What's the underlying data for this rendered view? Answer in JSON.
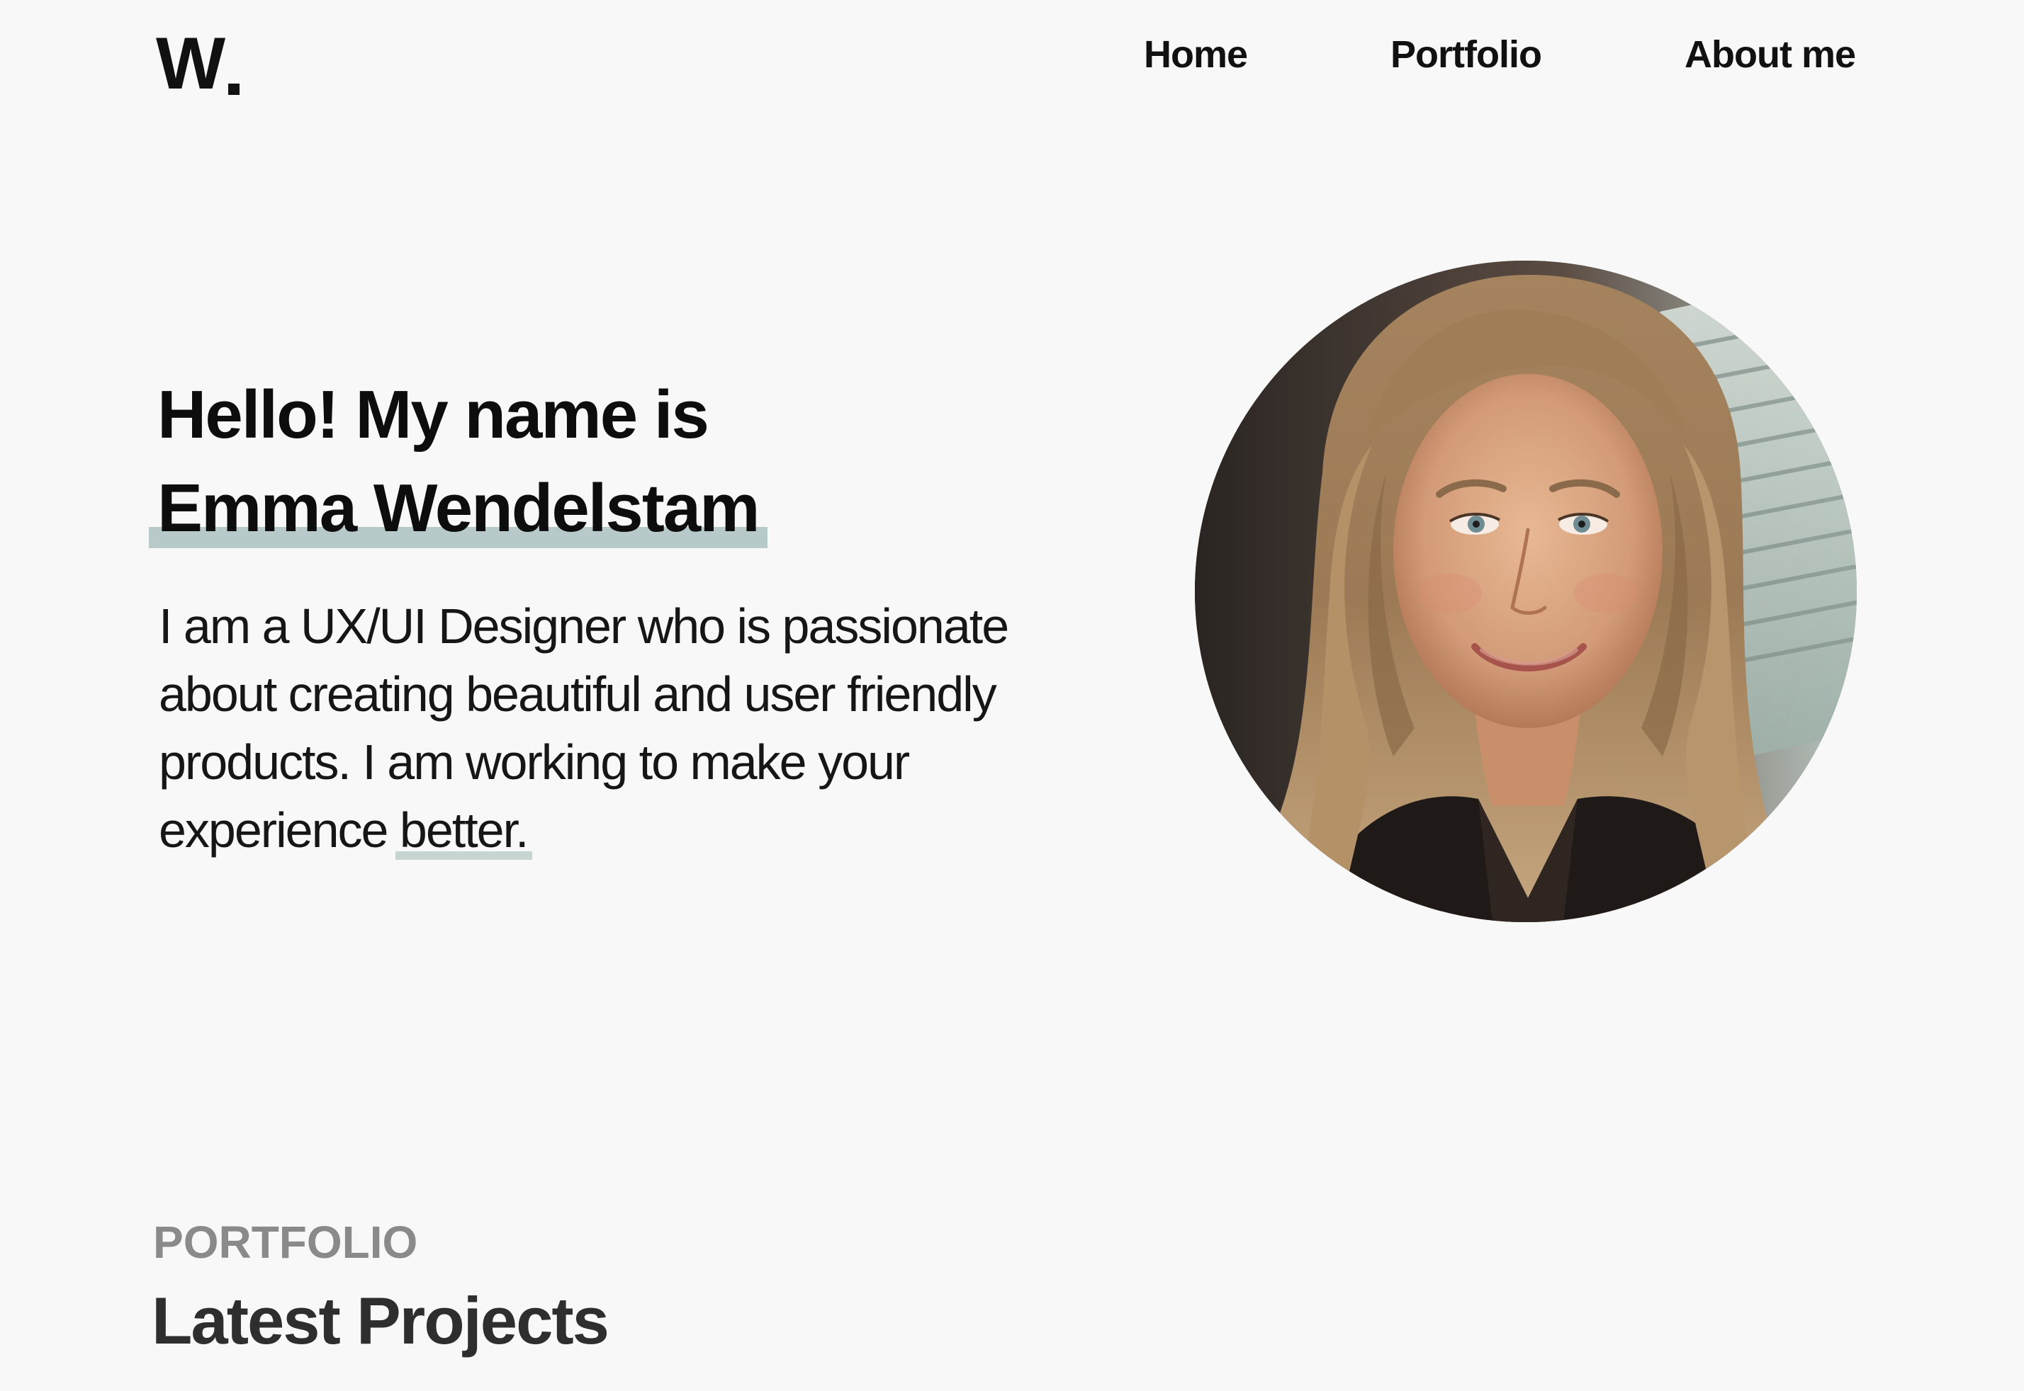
{
  "header": {
    "logo_text": "W.",
    "nav": [
      {
        "label": "Home"
      },
      {
        "label": "Portfolio"
      },
      {
        "label": "About me"
      }
    ]
  },
  "hero": {
    "greeting": "Hello! My name is",
    "name": "Emma Wendelstam",
    "description_main": "I am a UX/UI Designer who is passionate about creating beautiful and user friendly products. I am working to make your experience ",
    "description_highlight": "better.",
    "photo_alt": "Portrait of Emma Wendelstam"
  },
  "portfolio": {
    "eyebrow": "PORTFOLIO",
    "title": "Latest Projects"
  },
  "colors": {
    "background": "#f8f8f8",
    "text": "#111111",
    "highlight": "#b7c9c9",
    "eyebrow": "#8a8a8a"
  },
  "icons": {
    "logo": "w-logo-icon"
  }
}
